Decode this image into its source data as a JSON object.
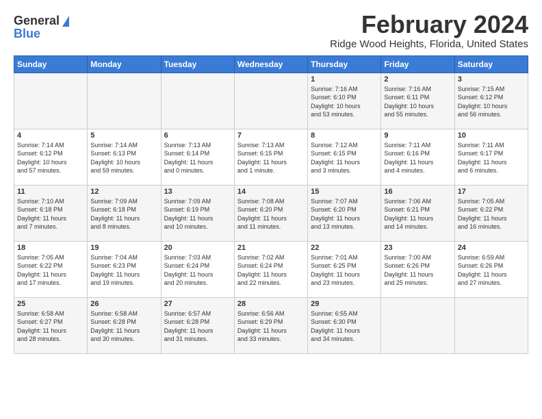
{
  "header": {
    "logo_general": "General",
    "logo_blue": "Blue",
    "month_title": "February 2024",
    "location": "Ridge Wood Heights, Florida, United States"
  },
  "weekdays": [
    "Sunday",
    "Monday",
    "Tuesday",
    "Wednesday",
    "Thursday",
    "Friday",
    "Saturday"
  ],
  "weeks": [
    [
      {
        "day": "",
        "content": ""
      },
      {
        "day": "",
        "content": ""
      },
      {
        "day": "",
        "content": ""
      },
      {
        "day": "",
        "content": ""
      },
      {
        "day": "1",
        "content": "Sunrise: 7:16 AM\nSunset: 6:10 PM\nDaylight: 10 hours\nand 53 minutes."
      },
      {
        "day": "2",
        "content": "Sunrise: 7:16 AM\nSunset: 6:11 PM\nDaylight: 10 hours\nand 55 minutes."
      },
      {
        "day": "3",
        "content": "Sunrise: 7:15 AM\nSunset: 6:12 PM\nDaylight: 10 hours\nand 56 minutes."
      }
    ],
    [
      {
        "day": "4",
        "content": "Sunrise: 7:14 AM\nSunset: 6:12 PM\nDaylight: 10 hours\nand 57 minutes."
      },
      {
        "day": "5",
        "content": "Sunrise: 7:14 AM\nSunset: 6:13 PM\nDaylight: 10 hours\nand 59 minutes."
      },
      {
        "day": "6",
        "content": "Sunrise: 7:13 AM\nSunset: 6:14 PM\nDaylight: 11 hours\nand 0 minutes."
      },
      {
        "day": "7",
        "content": "Sunrise: 7:13 AM\nSunset: 6:15 PM\nDaylight: 11 hours\nand 1 minute."
      },
      {
        "day": "8",
        "content": "Sunrise: 7:12 AM\nSunset: 6:15 PM\nDaylight: 11 hours\nand 3 minutes."
      },
      {
        "day": "9",
        "content": "Sunrise: 7:11 AM\nSunset: 6:16 PM\nDaylight: 11 hours\nand 4 minutes."
      },
      {
        "day": "10",
        "content": "Sunrise: 7:11 AM\nSunset: 6:17 PM\nDaylight: 11 hours\nand 6 minutes."
      }
    ],
    [
      {
        "day": "11",
        "content": "Sunrise: 7:10 AM\nSunset: 6:18 PM\nDaylight: 11 hours\nand 7 minutes."
      },
      {
        "day": "12",
        "content": "Sunrise: 7:09 AM\nSunset: 6:18 PM\nDaylight: 11 hours\nand 8 minutes."
      },
      {
        "day": "13",
        "content": "Sunrise: 7:09 AM\nSunset: 6:19 PM\nDaylight: 11 hours\nand 10 minutes."
      },
      {
        "day": "14",
        "content": "Sunrise: 7:08 AM\nSunset: 6:20 PM\nDaylight: 11 hours\nand 11 minutes."
      },
      {
        "day": "15",
        "content": "Sunrise: 7:07 AM\nSunset: 6:20 PM\nDaylight: 11 hours\nand 13 minutes."
      },
      {
        "day": "16",
        "content": "Sunrise: 7:06 AM\nSunset: 6:21 PM\nDaylight: 11 hours\nand 14 minutes."
      },
      {
        "day": "17",
        "content": "Sunrise: 7:05 AM\nSunset: 6:22 PM\nDaylight: 11 hours\nand 16 minutes."
      }
    ],
    [
      {
        "day": "18",
        "content": "Sunrise: 7:05 AM\nSunset: 6:22 PM\nDaylight: 11 hours\nand 17 minutes."
      },
      {
        "day": "19",
        "content": "Sunrise: 7:04 AM\nSunset: 6:23 PM\nDaylight: 11 hours\nand 19 minutes."
      },
      {
        "day": "20",
        "content": "Sunrise: 7:03 AM\nSunset: 6:24 PM\nDaylight: 11 hours\nand 20 minutes."
      },
      {
        "day": "21",
        "content": "Sunrise: 7:02 AM\nSunset: 6:24 PM\nDaylight: 11 hours\nand 22 minutes."
      },
      {
        "day": "22",
        "content": "Sunrise: 7:01 AM\nSunset: 6:25 PM\nDaylight: 11 hours\nand 23 minutes."
      },
      {
        "day": "23",
        "content": "Sunrise: 7:00 AM\nSunset: 6:26 PM\nDaylight: 11 hours\nand 25 minutes."
      },
      {
        "day": "24",
        "content": "Sunrise: 6:59 AM\nSunset: 6:26 PM\nDaylight: 11 hours\nand 27 minutes."
      }
    ],
    [
      {
        "day": "25",
        "content": "Sunrise: 6:58 AM\nSunset: 6:27 PM\nDaylight: 11 hours\nand 28 minutes."
      },
      {
        "day": "26",
        "content": "Sunrise: 6:58 AM\nSunset: 6:28 PM\nDaylight: 11 hours\nand 30 minutes."
      },
      {
        "day": "27",
        "content": "Sunrise: 6:57 AM\nSunset: 6:28 PM\nDaylight: 11 hours\nand 31 minutes."
      },
      {
        "day": "28",
        "content": "Sunrise: 6:56 AM\nSunset: 6:29 PM\nDaylight: 11 hours\nand 33 minutes."
      },
      {
        "day": "29",
        "content": "Sunrise: 6:55 AM\nSunset: 6:30 PM\nDaylight: 11 hours\nand 34 minutes."
      },
      {
        "day": "",
        "content": ""
      },
      {
        "day": "",
        "content": ""
      }
    ]
  ]
}
